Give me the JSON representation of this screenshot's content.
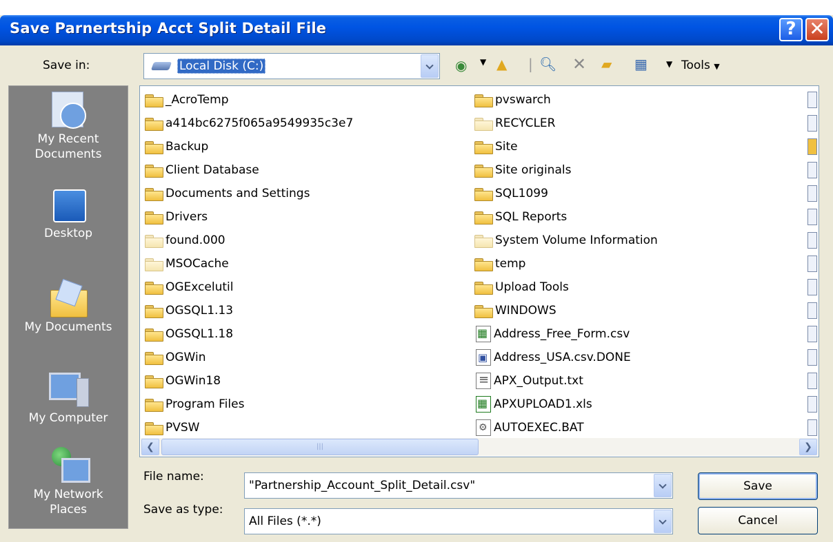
{
  "window": {
    "title": "Save Parnertship Acct Split Detail File",
    "help_label": "?",
    "close_label": "✕"
  },
  "save_in": {
    "label": "Save in:",
    "value": "Local Disk (C:)"
  },
  "toolbar": {
    "tools_label": "Tools"
  },
  "places": [
    {
      "label": "My Recent Documents",
      "icon": "recent-documents-icon"
    },
    {
      "label": "Desktop",
      "icon": "desktop-icon"
    },
    {
      "label": "My Documents",
      "icon": "my-documents-icon"
    },
    {
      "label": "My Computer",
      "icon": "my-computer-icon"
    },
    {
      "label": "My Network Places",
      "icon": "network-places-icon"
    }
  ],
  "files_col1": [
    "_AcroTemp",
    "a414bc6275f065a9549935c3e7",
    "Backup",
    "Client Database",
    "Documents and Settings",
    "Drivers",
    "found.000",
    "MSOCache",
    "OGExcelutil",
    "OGSQL1.13",
    "OGSQL1.18",
    "OGWin",
    "OGWin18",
    "Program Files",
    "PVSW"
  ],
  "files_col2": [
    "pvswarch",
    "RECYCLER",
    "Site",
    "Site originals",
    "SQL1099",
    "SQL Reports",
    "System Volume Information",
    "temp",
    "Upload Tools",
    "WINDOWS",
    "Address_Free_Form.csv",
    "Address_USA.csv.DONE",
    "APX_Output.txt",
    "APXUPLOAD1.xls",
    "AUTOEXEC.BAT"
  ],
  "file_name": {
    "label": "File name:",
    "value": "\"Partnership_Account_Split_Detail.csv\""
  },
  "save_type": {
    "label": "Save as type:",
    "value": "All Files (*.*)"
  },
  "buttons": {
    "save": "Save",
    "cancel": "Cancel"
  }
}
